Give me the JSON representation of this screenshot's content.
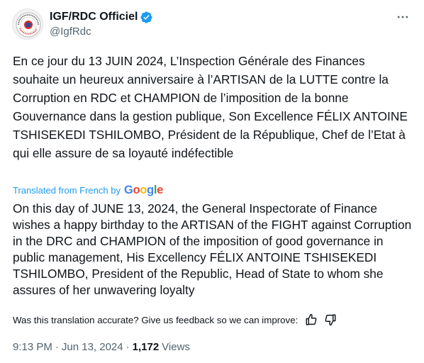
{
  "author": {
    "display_name": "IGF/RDC Officiel",
    "handle": "@IgfRdc",
    "avatar_icon": "igf-seal-logo",
    "avatar_text": "INSPECTION GÉNÉRALE DES FINANCES"
  },
  "icons": {
    "verified": "verified-badge-icon",
    "more": "more-options-icon",
    "thumb_up": "thumbs-up-icon",
    "thumb_down": "thumbs-down-icon"
  },
  "colors": {
    "accent": "#1d9bf0",
    "text": "#0f1419",
    "muted": "#536471"
  },
  "tweet": {
    "original_text": "En ce jour du 13 JUIN 2024, L’Inspection Générale des Finances souhaite un heureux anniversaire à l’ARTISAN de la LUTTE contre la Corruption en RDC et CHAMPION de l’imposition de la bonne Gouvernance dans la gestion publique, Son Excellence FÉLIX ANTOINE TSHISEKEDI TSHILOMBO, Président de la République, Chef de l’Etat à qui elle assure de sa loyauté indéfectible",
    "translated_from": "Translated from French by",
    "translator_brand": [
      "G",
      "o",
      "o",
      "g",
      "l",
      "e"
    ],
    "translation_text": "On this day of JUNE 13, 2024, the General Inspectorate of Finance wishes a happy birthday to the ARTISAN of the FIGHT against Corruption in the DRC and CHAMPION of the imposition of good governance in public management, His Excellency FÉLIX ANTOINE TSHISEKEDI TSHILOMBO, President of the Republic, Head of State to whom she assures of her unwavering loyalty",
    "feedback_prompt": "Was this translation accurate? Give us feedback so we can improve:",
    "time": "9:13 PM",
    "date": "Jun 13, 2024",
    "separator": "·",
    "views_count": "1,172",
    "views_label": "Views"
  }
}
